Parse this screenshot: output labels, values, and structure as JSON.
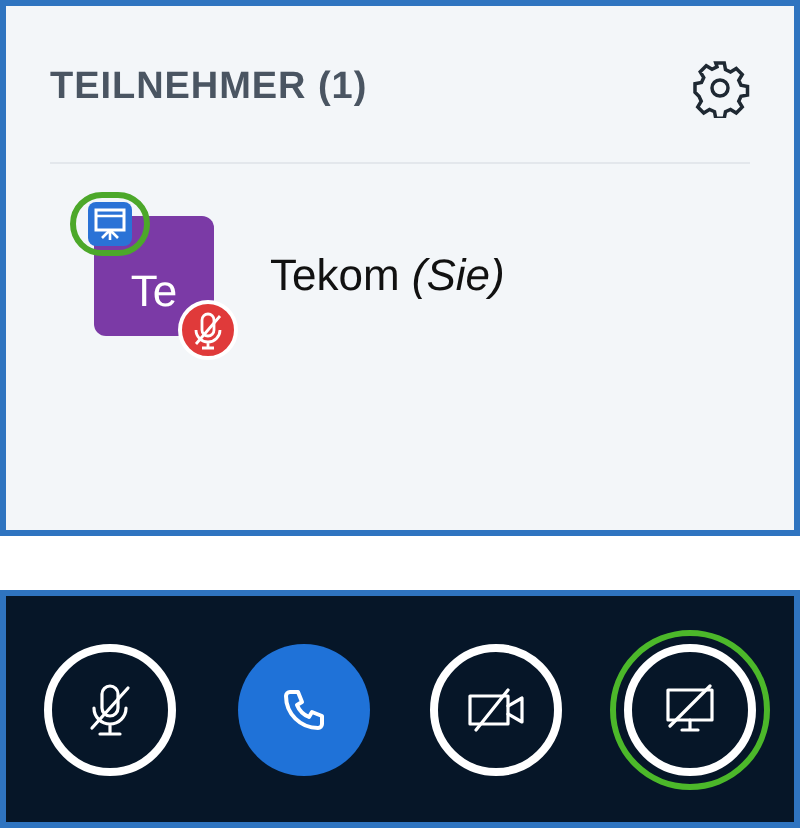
{
  "participants_panel": {
    "title": "TEILNEHMER (1)",
    "participants": [
      {
        "initials": "Te",
        "name": "Tekom *(Sie)*",
        "color": "#7b3aa6",
        "presenter": true,
        "presenter_highlighted": true,
        "muted": true
      }
    ]
  },
  "controls": [
    {
      "kind": "mic",
      "filled": false,
      "highlighted": false
    },
    {
      "kind": "phone",
      "filled": true,
      "highlighted": false
    },
    {
      "kind": "camera",
      "filled": false,
      "highlighted": false
    },
    {
      "kind": "screen",
      "filled": false,
      "highlighted": true
    }
  ]
}
